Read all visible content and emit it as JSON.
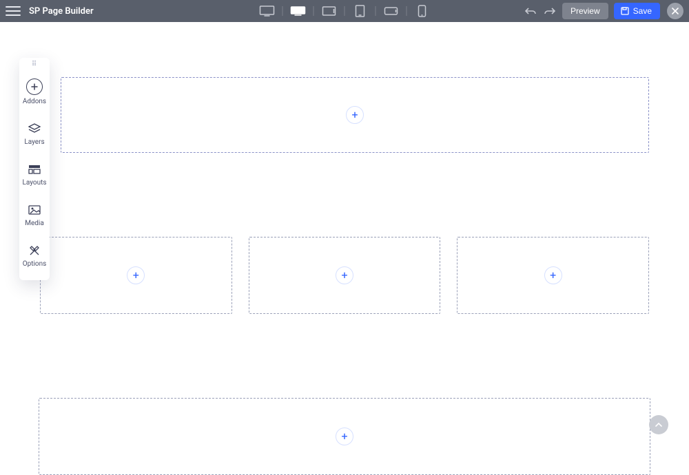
{
  "header": {
    "app_title": "SP Page Builder",
    "preview_label": "Preview",
    "save_label": "Save"
  },
  "devices": [
    {
      "name": "desktop-large",
      "active": false
    },
    {
      "name": "desktop",
      "active": true
    },
    {
      "name": "tablet-landscape",
      "active": false
    },
    {
      "name": "tablet",
      "active": false
    },
    {
      "name": "mobile-landscape",
      "active": false
    },
    {
      "name": "mobile",
      "active": false
    }
  ],
  "sidebar": {
    "items": [
      {
        "label": "Addons",
        "icon": "plus-circle-icon"
      },
      {
        "label": "Layers",
        "icon": "layers-icon"
      },
      {
        "label": "Layouts",
        "icon": "layouts-icon"
      },
      {
        "label": "Media",
        "icon": "media-icon"
      },
      {
        "label": "Options",
        "icon": "options-icon"
      }
    ]
  },
  "canvas": {
    "add_symbol": "+",
    "sections": [
      {
        "columns": 1
      },
      {
        "columns": 3
      },
      {
        "columns": 1
      }
    ]
  }
}
